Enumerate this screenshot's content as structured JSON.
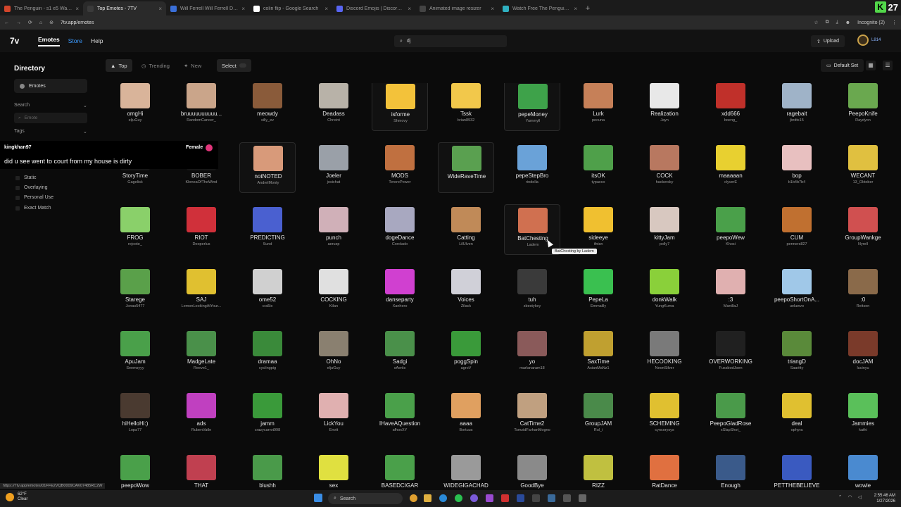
{
  "browser": {
    "tabs": [
      {
        "title": "The Penguin - s1 e5 Watch Fre",
        "color": "#d2452b",
        "active": false
      },
      {
        "title": "Top Emotes - 7TV",
        "color": "#3a3a3a",
        "active": true
      },
      {
        "title": "Will Ferrell Will Ferrell Dj GIF -",
        "color": "#3a6fd8",
        "active": false
      },
      {
        "title": "colin flip - Google Search",
        "color": "#ffffff",
        "active": false
      },
      {
        "title": "Discord Emojis | Discord & Sla",
        "color": "#5865f2",
        "active": false
      },
      {
        "title": "Animated image resizer",
        "color": "#444444",
        "active": false
      },
      {
        "title": "Watch Free The Penguin - Seri",
        "color": "#2fb0c0",
        "active": false
      }
    ],
    "new_tab": "+",
    "url": "7tv.app/emotes",
    "incognito": "Incognito (2)",
    "corner_badge": {
      "letter": "K",
      "number": "27"
    }
  },
  "nav": {
    "logo": "7v",
    "links": [
      "Emotes",
      "Store",
      "Help"
    ],
    "search_value": "dj",
    "upload": "Upload",
    "user_label": "L814"
  },
  "sidebar": {
    "title": "Directory",
    "emotes": "Emotes",
    "search_label": "Search",
    "search_placeholder": "Emote",
    "tags_label": "Tags",
    "options": [
      "Static",
      "Overlaying",
      "Personal Use",
      "Exact Match"
    ]
  },
  "chat_overlay": {
    "username": "kingkhan97",
    "gender": "Female",
    "message": "did u see went to court from my house is dirty"
  },
  "filters": {
    "top": "Top",
    "trending": "Trending",
    "new": "New",
    "select": "Select",
    "default_set": "Default Set"
  },
  "emotes": [
    [
      {
        "n": "omgHi",
        "a": "eljuGuy",
        "c": "#d9b49a"
      },
      {
        "n": "bruuuuuuuuuu...",
        "a": "RandomCancer_",
        "c": "#caa58a"
      },
      {
        "n": "meowdy",
        "a": "silly_ev",
        "c": "#8a5b3a"
      },
      {
        "n": "Deadass",
        "a": "Chreint",
        "c": "#b8b2a8"
      },
      {
        "n": "isforme",
        "a": "Shmovy",
        "c": "#f3c23a"
      },
      {
        "n": "Tssk",
        "a": "brian8932",
        "c": "#f2c84b"
      },
      {
        "n": "pepeMoney",
        "a": "Yummyll",
        "c": "#3ea24a"
      },
      {
        "n": "Lurk",
        "a": "pecuna",
        "c": "#c68058"
      },
      {
        "n": "Realization",
        "a": "Jayn",
        "c": "#e8e8e8"
      },
      {
        "n": "xdd666",
        "a": "boeng_",
        "c": "#c0302a"
      },
      {
        "n": "ragebait",
        "a": "jbrdtx15",
        "c": "#9fb3c8"
      },
      {
        "n": "PeepoKnife",
        "a": "Raydyon",
        "c": "#6aa84f"
      }
    ],
    [
      {
        "n": "StoryTime",
        "a": "Gagelisk",
        "c": "#161616"
      },
      {
        "n": "BOBER",
        "a": "KlonoaOfTheWind",
        "c": "#161616"
      },
      {
        "n": "notNOTED",
        "a": "AndrelMonty",
        "c": "#d89a7a"
      },
      {
        "n": "Joeler",
        "a": "josichat",
        "c": "#9aa0a8"
      },
      {
        "n": "MODS",
        "a": "TererePower",
        "c": "#c07040"
      },
      {
        "n": "WideRaveTime",
        "a": "",
        "c": "#5aa050"
      },
      {
        "n": "pepeStepBro",
        "a": "rindella",
        "c": "#6aa2d8"
      },
      {
        "n": "itsOK",
        "a": "typacco",
        "c": "#4fa04a"
      },
      {
        "n": "COCK",
        "a": "hackersky",
        "c": "#b87860"
      },
      {
        "n": "maaaaan",
        "a": "clyverE",
        "c": "#e8d030"
      },
      {
        "n": "bop",
        "a": "b1b4b7b4",
        "c": "#e8c0c0"
      },
      {
        "n": "WECANT",
        "a": "13_Oktober",
        "c": "#e0c040"
      }
    ],
    [
      {
        "n": "FROG",
        "a": "rejoote_",
        "c": "#8ad06a"
      },
      {
        "n": "RIOT",
        "a": "Dooperlus",
        "c": "#d0303a"
      },
      {
        "n": "PREDICTING",
        "a": "Sund",
        "c": "#4a60d0"
      },
      {
        "n": "punch",
        "a": "aeruzp",
        "c": "#d0b0b8"
      },
      {
        "n": "dogeDance",
        "a": "Corolado",
        "c": "#a8a8c0"
      },
      {
        "n": "Catting",
        "a": "LilUlven",
        "c": "#c08a58"
      },
      {
        "n": "BatChesting",
        "a": "Ladem",
        "c": "#d07050"
      },
      {
        "n": "sideeye",
        "a": "ifnisn",
        "c": "#f0c030"
      },
      {
        "n": "kittyJam",
        "a": "polly7",
        "c": "#d8c8c0"
      },
      {
        "n": "peepoWew",
        "a": "Khosi",
        "c": "#4aa04a"
      },
      {
        "n": "CUM",
        "a": "penners827",
        "c": "#c07030"
      },
      {
        "n": "GroupWankge",
        "a": "Nyrell",
        "c": "#d05050"
      }
    ],
    [
      {
        "n": "Starege",
        "a": "Jonas5477",
        "c": "#5aa04a"
      },
      {
        "n": "SAJ",
        "a": "LemonLookingAtYour...",
        "c": "#e0c030"
      },
      {
        "n": "ome52",
        "a": "cra5ix",
        "c": "#d0d0d0"
      },
      {
        "n": "COCKING",
        "a": "Kilan",
        "c": "#e0e0e0"
      },
      {
        "n": "danseparty",
        "a": "Xanhero",
        "c": "#d040d0"
      },
      {
        "n": "Voices",
        "a": "Zilack",
        "c": "#d0d0d8"
      },
      {
        "n": "tuh",
        "a": "zbestykey",
        "c": "#3a3a3a"
      },
      {
        "n": "PepeLa",
        "a": "Emmalily",
        "c": "#3ac050"
      },
      {
        "n": "donkWalk",
        "a": "YungKuma",
        "c": "#8ad03a"
      },
      {
        "n": ":3",
        "a": "ManillaJ",
        "c": "#e0b0b0"
      },
      {
        "n": "peepoShortOnA...",
        "a": "ueluwvo",
        "c": "#a0c8e8"
      },
      {
        "n": ":0",
        "a": "Reitsen",
        "c": "#8a6a4a"
      }
    ],
    [
      {
        "n": "ApuJam",
        "a": "Seemsyyy",
        "c": "#4aa04a"
      },
      {
        "n": "MadgeLate",
        "a": "Reeve1_",
        "c": "#4a904a"
      },
      {
        "n": "dramaa",
        "a": "cyclingpig",
        "c": "#3a8a3a"
      },
      {
        "n": "OhNo",
        "a": "eljuGuy",
        "c": "#8a8070"
      },
      {
        "n": "Sadgi",
        "a": "xAeriis",
        "c": "#4a904a"
      },
      {
        "n": "poggSpin",
        "a": "agroV",
        "c": "#3a9a3a"
      },
      {
        "n": "yo",
        "a": "marlanaram18",
        "c": "#8a5a5a"
      },
      {
        "n": "SaxTime",
        "a": "AsianMaNz1",
        "c": "#c0a030"
      },
      {
        "n": "HECOOKING",
        "a": "NeonSilver",
        "c": "#7a7a7a"
      },
      {
        "n": "OVERWORKING",
        "a": "FussbodJoen",
        "c": "#202020"
      },
      {
        "n": "triangD",
        "a": "Saaritty",
        "c": "#5a8a3a"
      },
      {
        "n": "docJAM",
        "a": "lucinyu",
        "c": "#7a3a2a"
      }
    ],
    [
      {
        "n": "hiHelloHi:)",
        "a": "Lopa77",
        "c": "#4a3a30"
      },
      {
        "n": "ads",
        "a": "RubenVatle",
        "c": "#c040c0"
      },
      {
        "n": "jamm",
        "a": "crazycarrot998",
        "c": "#3a9a3a"
      },
      {
        "n": "LickYou",
        "a": "Envtt",
        "c": "#e0b0b0"
      },
      {
        "n": "IHaveAQuestion",
        "a": "afhoxXY",
        "c": "#4aa04a"
      },
      {
        "n": "aaaa",
        "a": "Bortuus",
        "c": "#e0a060"
      },
      {
        "n": "CatTime2",
        "a": "TsmzidFarhanMogno",
        "c": "#c0a080"
      },
      {
        "n": "GroupJAM",
        "a": "Rul_i",
        "c": "#4a8a4a"
      },
      {
        "n": "SCHEMING",
        "a": "cyncorysys",
        "c": "#e0c030"
      },
      {
        "n": "PeepoGladRose",
        "a": "xSlapShot_",
        "c": "#4a9a4a"
      },
      {
        "n": "deal",
        "a": "ophyra",
        "c": "#e0c030"
      },
      {
        "n": "Jammies",
        "a": "kathi",
        "c": "#5ac05a"
      }
    ],
    [
      {
        "n": "peepoWow",
        "a": "",
        "c": "#4aa04a"
      },
      {
        "n": "THAT",
        "a": "",
        "c": "#c04050"
      },
      {
        "n": "blushh",
        "a": "",
        "c": "#4a9a4a"
      },
      {
        "n": "sex",
        "a": "",
        "c": "#e0e040"
      },
      {
        "n": "BASEDCIGAR",
        "a": "",
        "c": "#4aa04a"
      },
      {
        "n": "WIDEGIGACHAD",
        "a": "",
        "c": "#9a9a9a"
      },
      {
        "n": "GoodBye",
        "a": "",
        "c": "#8a8a8a"
      },
      {
        "n": "RIZZ",
        "a": "",
        "c": "#c0c040"
      },
      {
        "n": "RatDance",
        "a": "",
        "c": "#e07040"
      },
      {
        "n": "Enough",
        "a": "",
        "c": "#3a5a8a"
      },
      {
        "n": "PETTHEBELIEVE",
        "a": "",
        "c": "#3a5ac0"
      },
      {
        "n": "wowie",
        "a": "",
        "c": "#4a8ad0"
      }
    ]
  ],
  "tooltip": "BatChesting by Ladem",
  "status_url": "https://7tv.app/emotes/01FFE2VQB0009CAK07485RC2W",
  "taskbar": {
    "temp": "62°F",
    "condition": "Clear",
    "search": "Search",
    "time": "2:55:46 AM",
    "date": "1/27/2026"
  }
}
